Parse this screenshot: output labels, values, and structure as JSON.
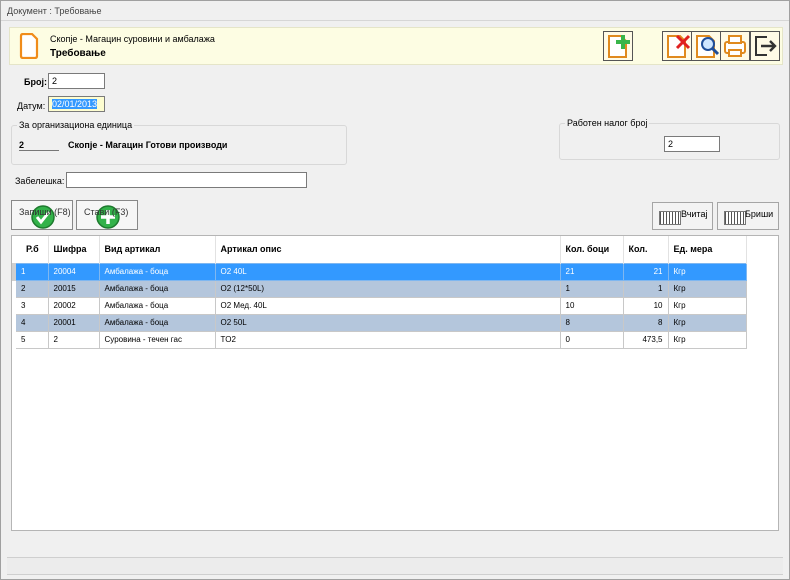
{
  "window": {
    "title": "Документ : Требовање"
  },
  "header": {
    "subtitle": "Скопје - Магацин суровини и амбалажа",
    "title": "Требовање"
  },
  "form": {
    "broj_label": "Број:",
    "broj_value": "2",
    "datum_label": "Датум:",
    "datum_value": "02/01/2013",
    "org_group_title": "За организациона единица",
    "org_code": "2",
    "org_name": "Скопје - Магацин Готови производи",
    "work_order_title": "Работен налог број",
    "work_order_value": "2",
    "note_label": "Забелешка:",
    "note_value": ""
  },
  "buttons": {
    "save": "Запиши (F8)",
    "add_item": "Стави (F3)",
    "load": "Вчитај",
    "delete": "Бриши"
  },
  "toolbar_icons": [
    "new-document-icon",
    "delete-document-icon",
    "preview-icon",
    "print-icon",
    "exit-icon"
  ],
  "colors": {
    "selected_row": "#3399ff",
    "alt_row": "#b4c6dc",
    "header_bg": "#fdfde3"
  },
  "table": {
    "columns": [
      "Р.б",
      "Шифра",
      "Вид артикал",
      "Артикал опис",
      "Кол. боци",
      "Кол.",
      "Ед. мера"
    ],
    "rows": [
      [
        "1",
        "20004",
        "Амбалажа - боца",
        "O2 40L",
        "21",
        "21",
        "Кгр"
      ],
      [
        "2",
        "20015",
        "Амбалажа - боца",
        "O2 (12*50L)",
        "1",
        "1",
        "Кгр"
      ],
      [
        "3",
        "20002",
        "Амбалажа - боца",
        "O2 Мед. 40L",
        "10",
        "10",
        "Кгр"
      ],
      [
        "4",
        "20001",
        "Амбалажа - боца",
        "O2 50L",
        "8",
        "8",
        "Кгр"
      ],
      [
        "5",
        "2",
        "Суровина - течен гас",
        "TO2",
        "0",
        "473,5",
        "Кгр"
      ]
    ]
  }
}
